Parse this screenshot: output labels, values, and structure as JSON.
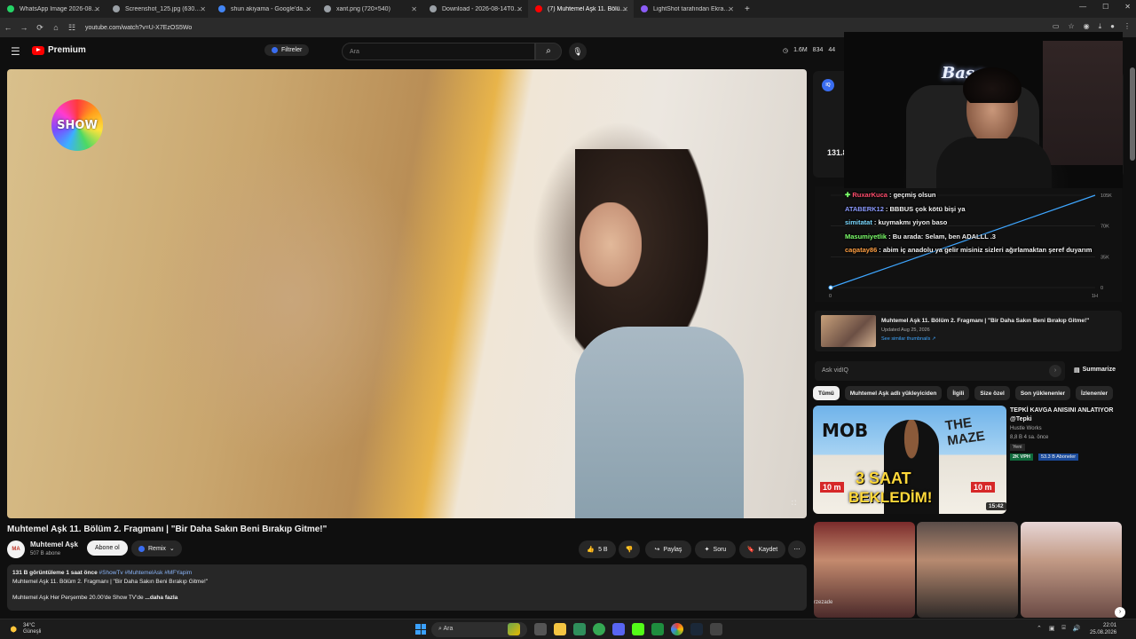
{
  "browser": {
    "tabs": [
      {
        "label": "WhatsApp Image 2026-08-25 a",
        "color": "#25d366"
      },
      {
        "label": "Screenshot_125.jpg (630×892)",
        "color": "#9aa0a6"
      },
      {
        "label": "shun akiyama - Google'da Ara",
        "color": "#4285f4"
      },
      {
        "label": "xant.png (720×540)",
        "color": "#9aa0a6"
      },
      {
        "label": "Download - 2026-08-14T0227",
        "color": "#9aa0a6"
      },
      {
        "label": "(7) Muhtemel Aşk 11. Bölüm 2.",
        "color": "#ff0000"
      },
      {
        "label": "LightShot tarafından Ekran Gör",
        "color": "#8b5cf6"
      }
    ],
    "new_tab": "+",
    "url": "youtube.com/watch?v=U-X7EzOS5Wo"
  },
  "youtube": {
    "logo_text": "Premium",
    "filters_label": "Filtreler",
    "search_placeholder": "Ara",
    "stats": {
      "views": "1.6M",
      "likes": "834",
      "third": "44"
    }
  },
  "video": {
    "channel_logo_text": "SHOW",
    "title": "Muhtemel Aşk 11. Bölüm 2. Fragmanı | \"Bir Daha Sakın Beni Bırakıp Gitme!\"",
    "channel": "Muhtemel Aşk",
    "channel_avatar": "MA",
    "subscribers": "507 B abone",
    "subscribe_label": "Abone ol",
    "remix_label": "Remix",
    "like_count": "5 B",
    "share_label": "Paylaş",
    "ask_label": "Soru",
    "save_label": "Kaydet",
    "more_label": "⋯"
  },
  "description": {
    "meta": "131 B görüntüleme  1 saat önce",
    "tags": "#ShowTv #MuhtemelAsk #MFYapim",
    "line1": "Muhtemel Aşk 11. Bölüm 2. Fragmanı | \"Bir Daha Sakın Beni Bırakıp Gitme!\"",
    "line2": "Muhtemel Aşk Her Perşembe 20.00'de Show TV'de",
    "more": "...daha fazla"
  },
  "vidiq": {
    "badge": "IQ",
    "view_count": "131.8"
  },
  "webcam": {
    "neon_sign": "Başo"
  },
  "chat": [
    {
      "user": "RuxarKuca",
      "message": "geçmiş olsun",
      "color": "#ff4d6d"
    },
    {
      "user": "ATABERK12",
      "message": "BBBUS çok kötü bişi ya",
      "color": "#8c9bff"
    },
    {
      "user": "simitatat",
      "message": "kuymakmı yiyon baso",
      "color": "#7bd9ff"
    },
    {
      "user": "Masumiyetlik",
      "message": "Bu arada: Selam, ben ADALLL .3",
      "color": "#7cff6b"
    },
    {
      "user": "cagatay86",
      "message": "abim iç anadolu ya gelir misiniz sizleri ağırlamaktan şeref duyarım",
      "color": "#ff9f43"
    }
  ],
  "chart_data": {
    "type": "line",
    "x": [
      "0",
      "1H"
    ],
    "y": [
      0,
      105000
    ],
    "ytick_labels": [
      "105K",
      "70K",
      "35K",
      "0"
    ],
    "ylim": [
      0,
      105000
    ],
    "xlabel": "",
    "ylabel": "",
    "line_color": "#3ea6ff"
  },
  "related_top": {
    "title": "Muhtemel Aşk 11. Bölüm 2. Fragmanı | \"Bir Daha Sakın Beni Bırakıp Gitme!\"",
    "updated": "Updated Aug 25, 2026",
    "link": "See similar thumbnails ↗"
  },
  "ask": {
    "placeholder": "Ask vidIQ",
    "summarize_label": "Summarize"
  },
  "chips": [
    "Tümü",
    "Muhtemel Aşk adlı yükleyiciden",
    "İlgili",
    "Size özel",
    "Son yüklenenler",
    "İzlenenler"
  ],
  "recommended": {
    "title": "TEPKİ KAVGA ANISINI ANLATIYOR @Tepki",
    "channel": "Hustle Works",
    "views": "8,8 B   4 sa. önce",
    "new_badge": "Yeni",
    "vph": "2K VPH",
    "abone": "53.3 B Aboneler",
    "duration": "15:42",
    "thumb_mob": "MOB",
    "thumb_maze": "THE MAZE",
    "thumb_3saat": "3 SAAT",
    "thumb_bekledim": "BEKLEDİM!",
    "thumb_10m": "10 m"
  },
  "shorts_label": "rzezade",
  "taskbar": {
    "temp": "34°C",
    "weather": "Güneşli",
    "search": "Ara",
    "time": "22:01",
    "date": "25.08.2026"
  }
}
